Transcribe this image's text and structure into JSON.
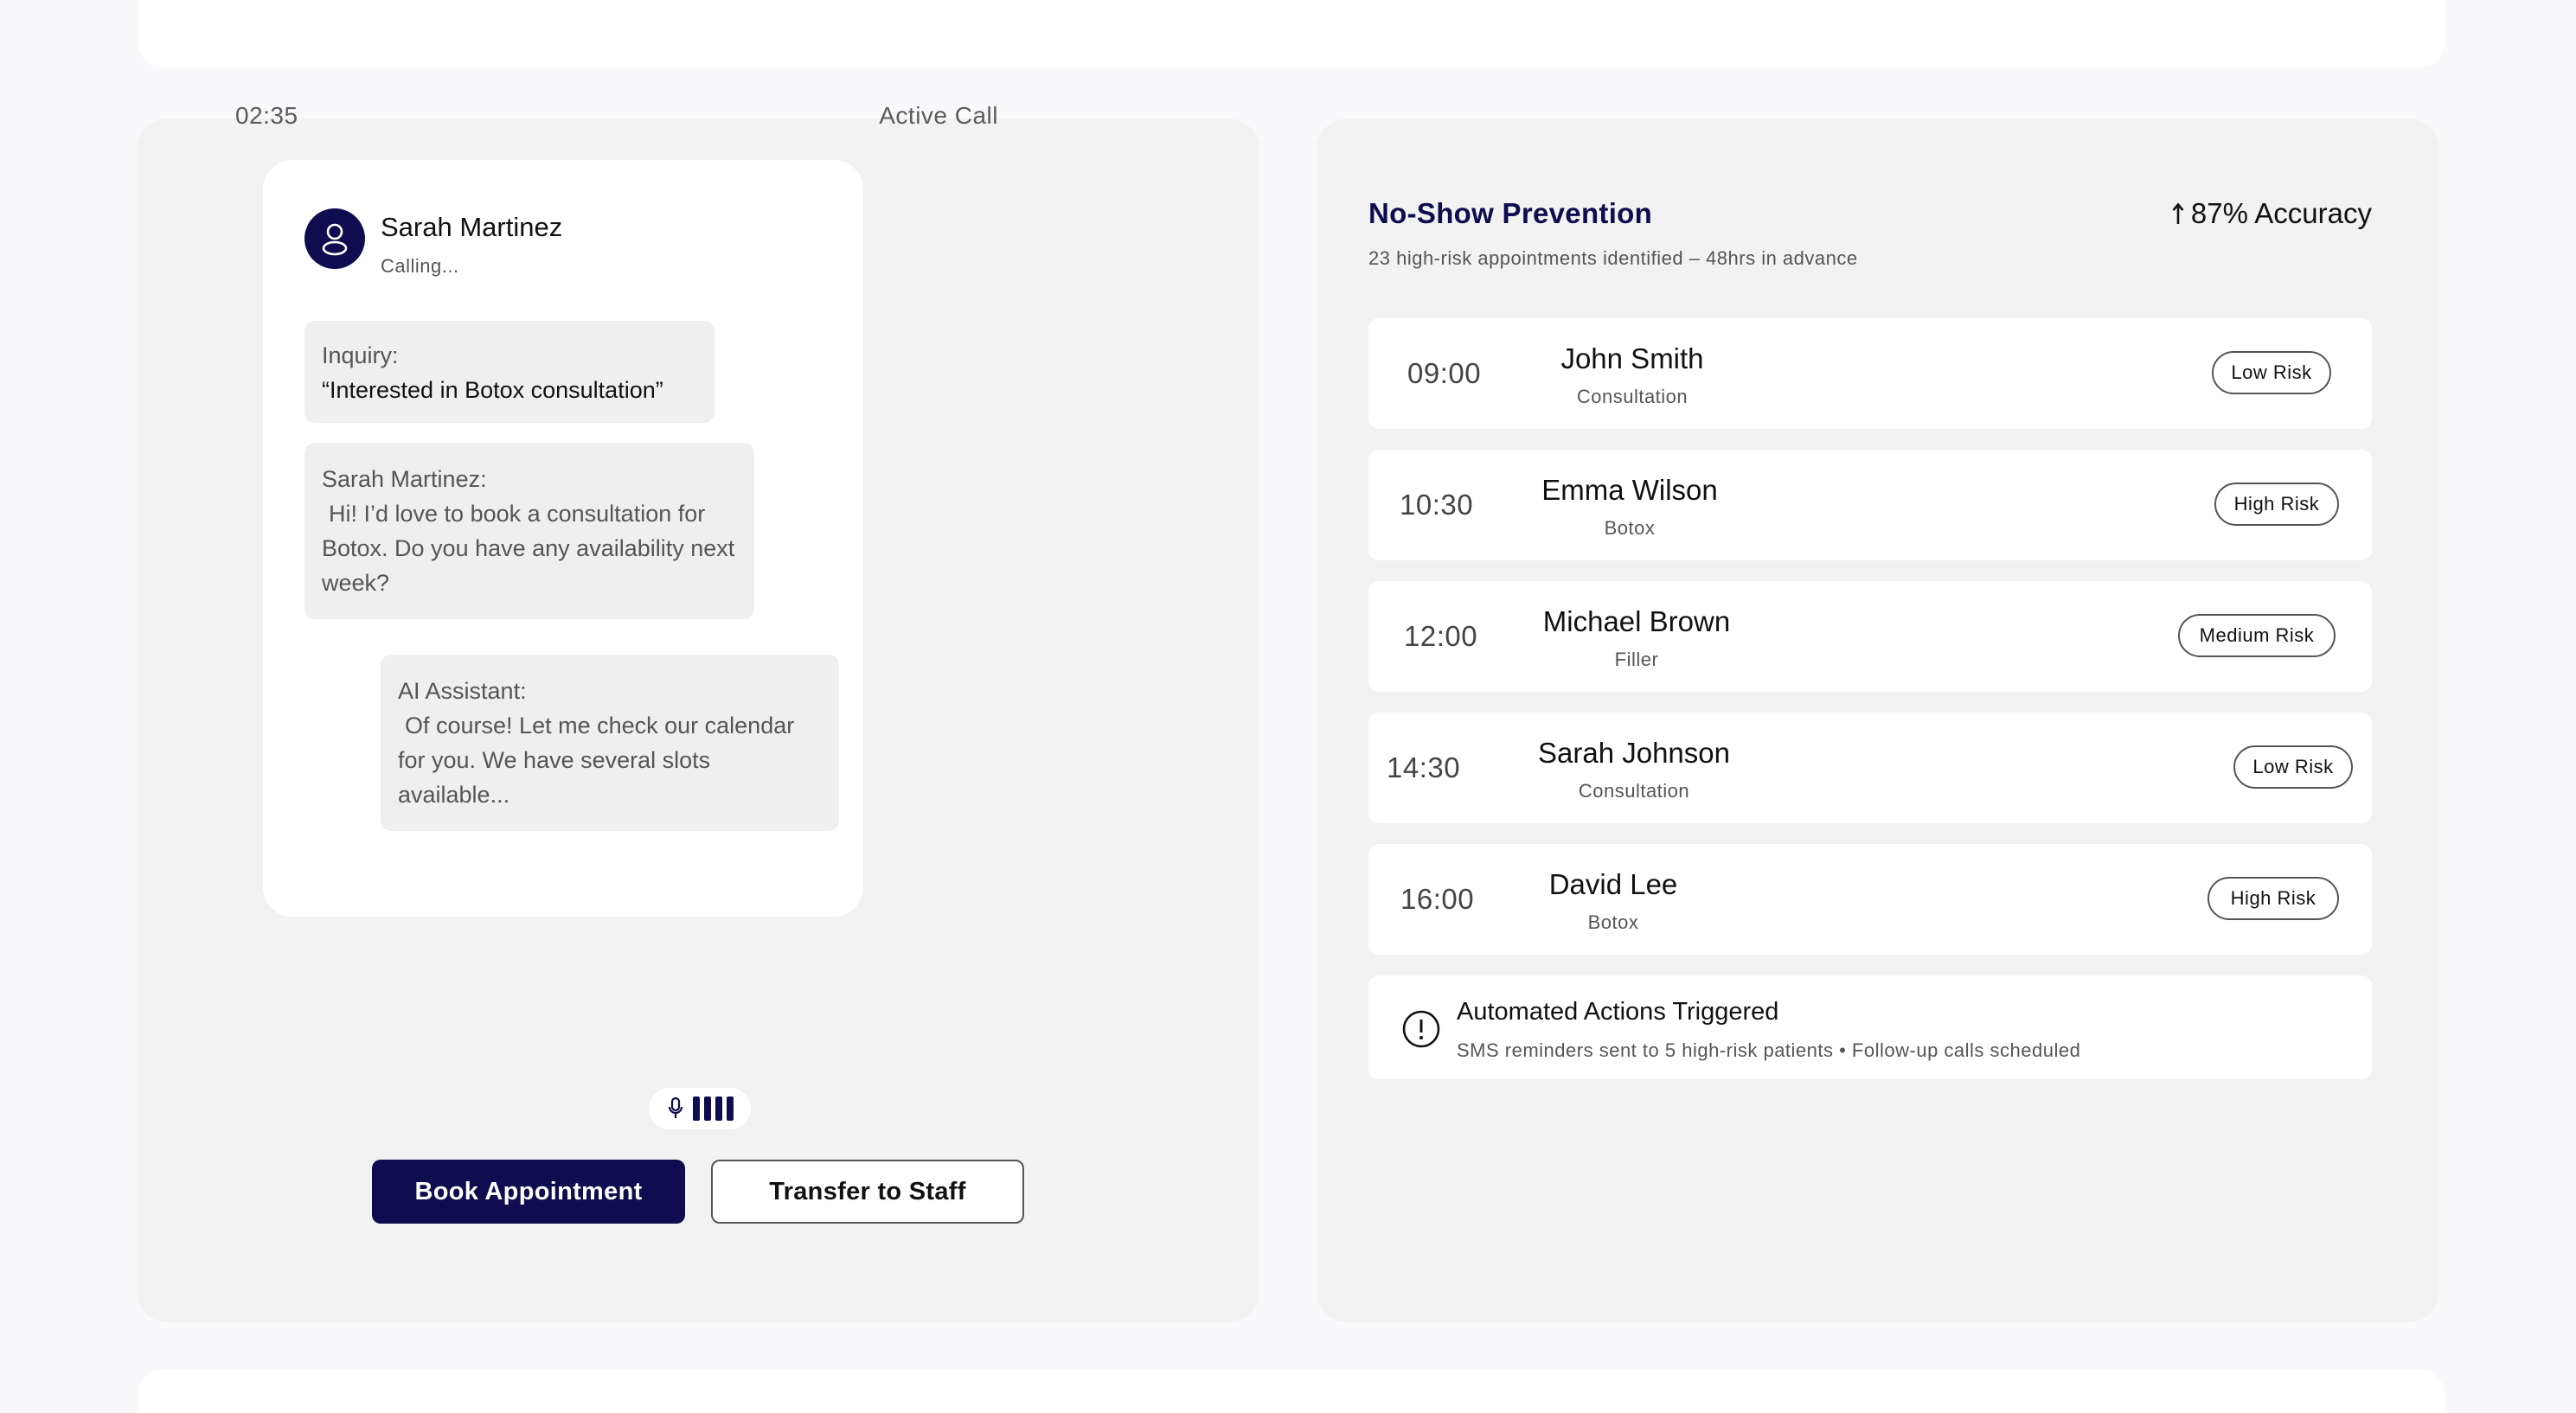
{
  "call": {
    "timer": "02:35",
    "status": "Active Call",
    "caller_name": "Sarah Martinez",
    "caller_status": "Calling...",
    "inquiry_label": "Inquiry:",
    "inquiry_text": "“Interested in Botox consultation”",
    "user_label": "Sarah Martinez:",
    "user_text": "Hi! I’d love to book a consultation for Botox. Do you have any availability next week?",
    "ai_label": "AI Assistant:",
    "ai_text": "Of course! Let me check our calendar for you. We have several slots available...",
    "book_button": "Book Appointment",
    "transfer_button": "Transfer to Staff"
  },
  "prevention": {
    "title": "No-Show Prevention",
    "accuracy": "87% Accuracy",
    "subtitle": "23 high-risk appointments identified – 48hrs in advance",
    "appointments": [
      {
        "time": "09:00",
        "name": "John Smith",
        "type": "Consultation",
        "risk": "Low Risk"
      },
      {
        "time": "10:30",
        "name": "Emma Wilson",
        "type": "Botox",
        "risk": "High Risk"
      },
      {
        "time": "12:00",
        "name": "Michael Brown",
        "type": "Filler",
        "risk": "Medium Risk"
      },
      {
        "time": "14:30",
        "name": "Sarah Johnson",
        "type": "Consultation",
        "risk": "Low Risk"
      },
      {
        "time": "16:00",
        "name": "David Lee",
        "type": "Botox",
        "risk": "High Risk"
      }
    ],
    "auto_title": "Automated Actions Triggered",
    "auto_text": "SMS reminders sent to 5 high-risk patients • Follow-up calls scheduled"
  },
  "colors": {
    "brand": "#0d0d4f",
    "panel": "#f2f2f2",
    "card": "#ffffff"
  }
}
